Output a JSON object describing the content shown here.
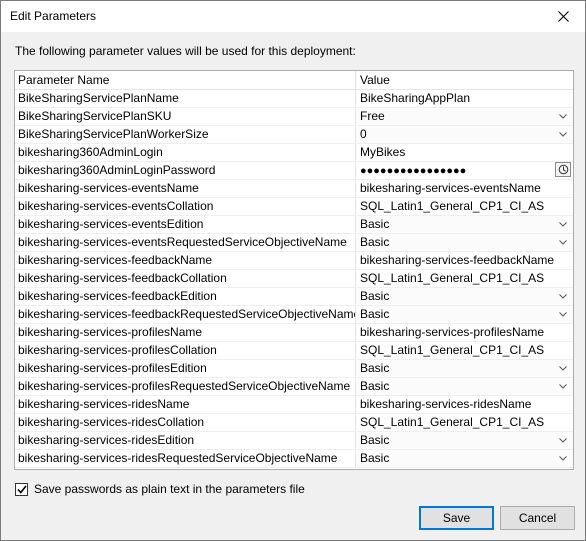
{
  "window": {
    "title": "Edit Parameters"
  },
  "intro_text": "The following parameter values will be used for this deployment:",
  "table": {
    "columns": [
      "Parameter Name",
      "Value"
    ],
    "rows": [
      {
        "name": "BikeSharingServicePlanName",
        "value": "BikeSharingAppPlan",
        "type": "text"
      },
      {
        "name": "BikeSharingServicePlanSKU",
        "value": "Free",
        "type": "select"
      },
      {
        "name": "BikeSharingServicePlanWorkerSize",
        "value": "0",
        "type": "select"
      },
      {
        "name": "bikesharing360AdminLogin",
        "value": "MyBikes",
        "type": "text"
      },
      {
        "name": "bikesharing360AdminLoginPassword",
        "value": "●●●●●●●●●●●●●●●●",
        "type": "password"
      },
      {
        "name": "bikesharing-services-eventsName",
        "value": "bikesharing-services-eventsName",
        "type": "text"
      },
      {
        "name": "bikesharing-services-eventsCollation",
        "value": "SQL_Latin1_General_CP1_CI_AS",
        "type": "text"
      },
      {
        "name": "bikesharing-services-eventsEdition",
        "value": "Basic",
        "type": "select"
      },
      {
        "name": "bikesharing-services-eventsRequestedServiceObjectiveName",
        "value": "Basic",
        "type": "select"
      },
      {
        "name": "bikesharing-services-feedbackName",
        "value": "bikesharing-services-feedbackName",
        "type": "text"
      },
      {
        "name": "bikesharing-services-feedbackCollation",
        "value": "SQL_Latin1_General_CP1_CI_AS",
        "type": "text"
      },
      {
        "name": "bikesharing-services-feedbackEdition",
        "value": "Basic",
        "type": "select"
      },
      {
        "name": "bikesharing-services-feedbackRequestedServiceObjectiveName",
        "value": "Basic",
        "type": "select"
      },
      {
        "name": "bikesharing-services-profilesName",
        "value": "bikesharing-services-profilesName",
        "type": "text"
      },
      {
        "name": "bikesharing-services-profilesCollation",
        "value": "SQL_Latin1_General_CP1_CI_AS",
        "type": "text"
      },
      {
        "name": "bikesharing-services-profilesEdition",
        "value": "Basic",
        "type": "select"
      },
      {
        "name": "bikesharing-services-profilesRequestedServiceObjectiveName",
        "value": "Basic",
        "type": "select"
      },
      {
        "name": "bikesharing-services-ridesName",
        "value": "bikesharing-services-ridesName",
        "type": "text"
      },
      {
        "name": "bikesharing-services-ridesCollation",
        "value": "SQL_Latin1_General_CP1_CI_AS",
        "type": "text"
      },
      {
        "name": "bikesharing-services-ridesEdition",
        "value": "Basic",
        "type": "select"
      },
      {
        "name": "bikesharing-services-ridesRequestedServiceObjectiveName",
        "value": "Basic",
        "type": "select"
      }
    ]
  },
  "save_passwords": {
    "label": "Save passwords as plain text in the parameters file",
    "checked": true
  },
  "buttons": {
    "save": "Save",
    "cancel": "Cancel"
  },
  "icons": {
    "close": "close-icon",
    "dropdown": "chevron-down-icon",
    "password_toggle": "password-reveal-icon"
  },
  "colors": {
    "primary_border": "#0078d7"
  }
}
